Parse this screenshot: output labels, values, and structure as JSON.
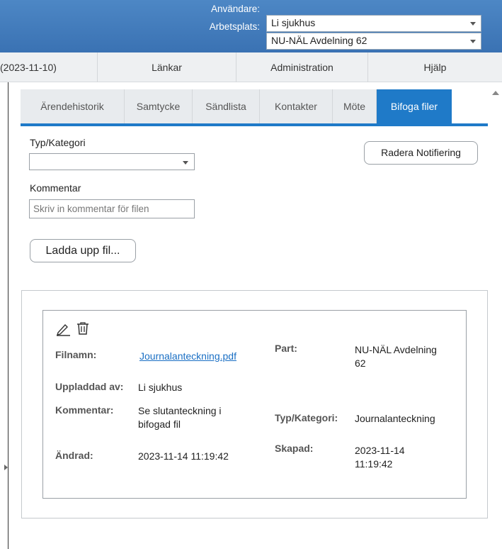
{
  "header": {
    "user_label": "Användare:",
    "user_value": "Li sjukhus",
    "workplace_label": "Arbetsplats:",
    "workplace_value": "NU-NÄL Avdelning 62"
  },
  "menu": {
    "items": [
      "(2023-11-10)",
      "Länkar",
      "Administration",
      "Hjälp"
    ]
  },
  "tabs": [
    "Ärendehistorik",
    "Samtycke",
    "Sändlista",
    "Kontakter",
    "Möte",
    "Bifoga filer"
  ],
  "form": {
    "category_label": "Typ/Kategori",
    "category_value": "",
    "comment_label": "Kommentar",
    "comment_placeholder": "Skriv in kommentar för filen",
    "delete_notification_label": "Radera Notifiering",
    "upload_label": "Ladda upp fil..."
  },
  "file": {
    "filename_key": "Filnamn:",
    "filename_value": "Journalanteckning.pdf",
    "uploaded_by_key": "Uppladdad av:",
    "uploaded_by_value": "Li sjukhus",
    "comment_key": "Kommentar:",
    "comment_value_line1": "Se slutanteckning i",
    "comment_value_line2": "bifogad fil",
    "changed_key": "Ändrad:",
    "changed_value": "2023-11-14 11:19:42",
    "part_key": "Part:",
    "part_value_line1": "NU-NÄL Avdelning",
    "part_value_line2": "62",
    "category_key": "Typ/Kategori:",
    "category_value": "Journalanteckning",
    "created_key": "Skapad:",
    "created_value_line1": "2023-11-14",
    "created_value_line2": "11:19:42"
  },
  "icons": {
    "edit": "pencil-icon",
    "delete": "trash-icon"
  },
  "colors": {
    "header_blue": "#3a72b3",
    "active_tab": "#1f7ac8",
    "link": "#1a6fc4"
  }
}
